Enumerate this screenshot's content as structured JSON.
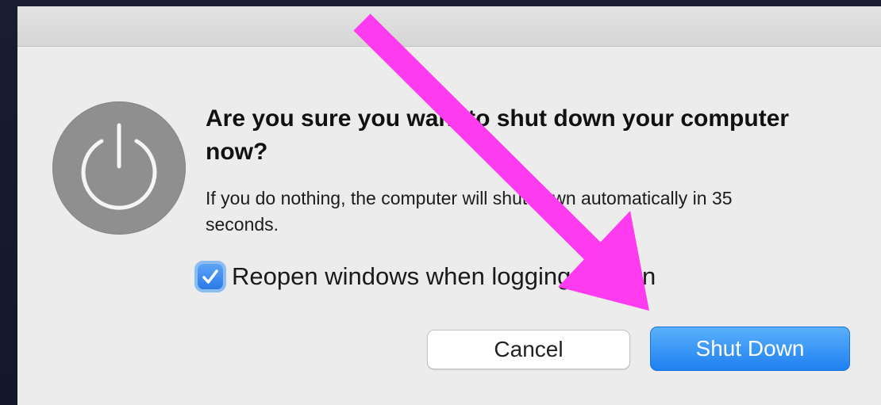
{
  "dialog": {
    "headline": "Are you sure you want to shut down your computer now?",
    "detail": "If you do nothing, the computer will shut down automatically in 35 seconds.",
    "power_icon": "power-icon",
    "reopen_windows": {
      "label": "Reopen windows when logging back in",
      "checked": true
    },
    "buttons": {
      "cancel_label": "Cancel",
      "shut_down_label": "Shut Down"
    }
  },
  "annotation": {
    "arrow_color": "#ff3bef",
    "arrow_icon": "arrow-icon"
  },
  "colors": {
    "accent": "#1f80f1",
    "dialog_bg": "#ececec",
    "backdrop": "#181b2c"
  }
}
